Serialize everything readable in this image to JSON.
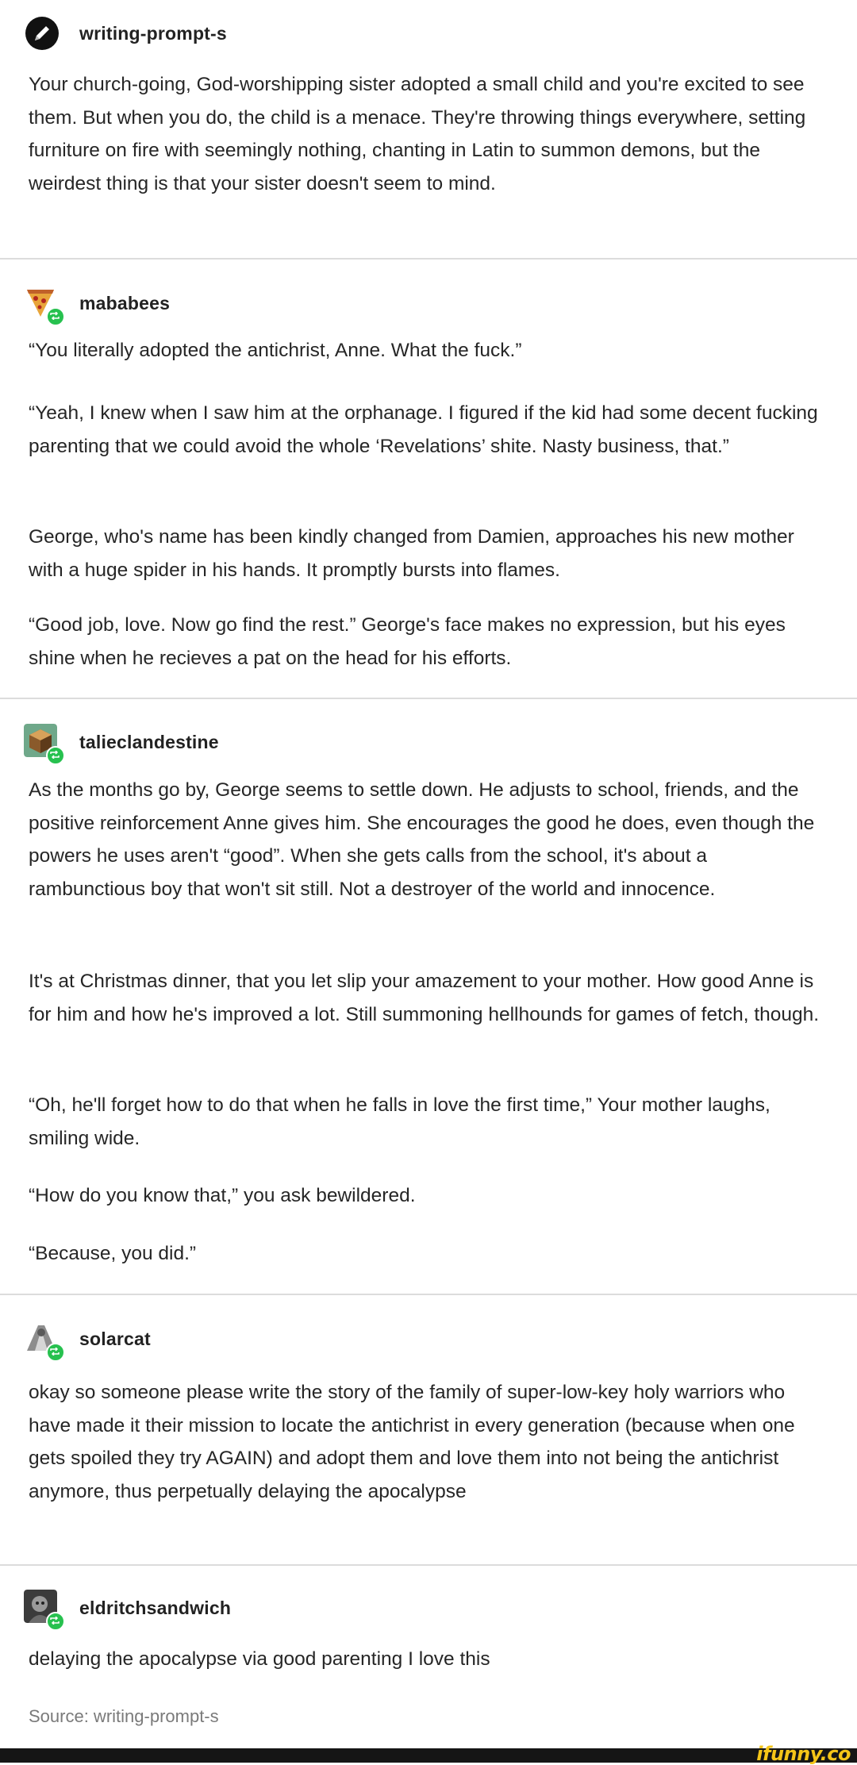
{
  "posts": [
    {
      "username": "writing-prompt-s",
      "paragraphs": [
        "Your church-going, God-worshipping sister adopted a small child and you're excited to see them. But when you do, the child is a menace. They're throwing things everywhere, setting furniture on fire with seemingly nothing, chanting in Latin to summon demons, but the weirdest thing is that your sister doesn't seem to mind."
      ]
    },
    {
      "username": "mababees",
      "paragraphs": [
        "“You literally adopted the antichrist, Anne. What the fuck.”",
        "“Yeah, I knew when I saw him at the orphanage. I figured if the kid had some decent fucking parenting that we could avoid the whole ‘Revelations’ shite. Nasty business, that.”",
        "George, who's name has been kindly changed from Damien, approaches his new mother with a huge spider in his hands. It promptly bursts into flames.",
        "“Good job, love. Now go find the rest.” George's face makes no expression, but his eyes shine when he recieves a pat on the head for his efforts."
      ]
    },
    {
      "username": "talieclandestine",
      "paragraphs": [
        "As the months go by, George seems to settle down. He adjusts to school, friends, and the positive reinforcement Anne gives him. She encourages the good he does, even though the powers he uses aren't “good”. When she gets calls from the school, it's about a rambunctious boy that won't sit still. Not a destroyer of the world and innocence.",
        "It's at Christmas dinner, that you let slip your amazement to your mother. How good Anne is for him and how he's improved a lot. Still summoning hellhounds for games of fetch, though.",
        "“Oh, he'll forget how to do that when he falls in love the first time,” Your mother laughs, smiling wide.",
        "“How do you know that,” you ask bewildered.",
        "“Because, you did.”"
      ]
    },
    {
      "username": "solarcat",
      "paragraphs": [
        "okay so someone please write the story of the family of super-low-key holy warriors who have made it their mission to locate the antichrist in every generation (because when one gets spoiled they try AGAIN) and adopt them and love them into not being the antichrist anymore, thus perpetually delaying the apocalypse"
      ]
    },
    {
      "username": "eldritchsandwich",
      "paragraphs": [
        "delaying the apocalypse via good parenting I love this"
      ]
    }
  ],
  "source": "Source: writing-prompt-s",
  "watermark": "ifunny.co",
  "icons": {
    "post0": "pencil-icon",
    "post1": "pizza-avatar-icon",
    "post2": "cube-avatar-icon",
    "post3": "anime-avatar-icon",
    "post4": "portrait-avatar-icon",
    "badge": "reblog-badge-icon"
  },
  "colors": {
    "badge": "#27c14f",
    "watermark": "#f5c518",
    "divider": "#dcdcdc"
  }
}
